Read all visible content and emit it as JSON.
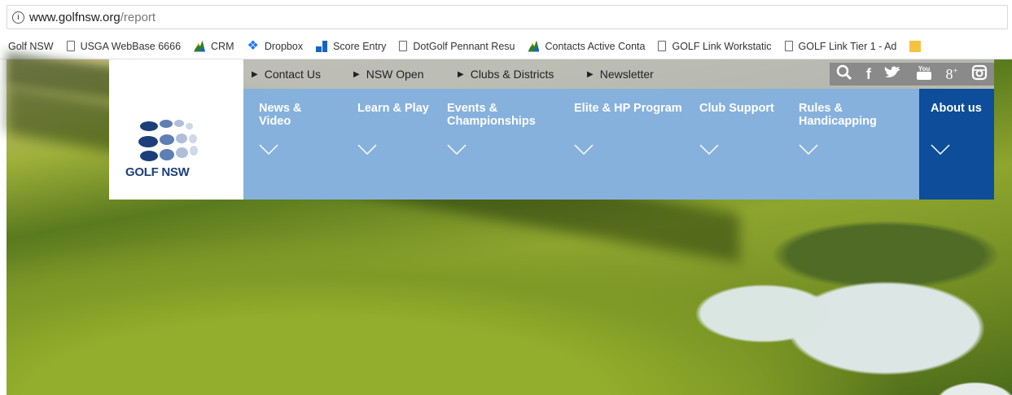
{
  "browser": {
    "url_host": "www.golfnsw.org",
    "url_path": "/report",
    "bookmarks": [
      {
        "label": "Golf NSW",
        "icon": "none"
      },
      {
        "label": "USGA WebBase 6666",
        "icon": "page-icon"
      },
      {
        "label": "CRM",
        "icon": "crm-icon"
      },
      {
        "label": "Dropbox",
        "icon": "dropbox-icon"
      },
      {
        "label": "Score Entry",
        "icon": "score-entry-icon"
      },
      {
        "label": "DotGolf Pennant Resu",
        "icon": "page-icon"
      },
      {
        "label": "Contacts Active Conta",
        "icon": "crm-icon"
      },
      {
        "label": "GOLF Link Workstatic",
        "icon": "page-icon"
      },
      {
        "label": "GOLF Link Tier 1 - Ad",
        "icon": "page-icon"
      }
    ]
  },
  "site": {
    "logo_text": "GOLF NSW",
    "top_links": [
      "Contact Us",
      "NSW Open",
      "Clubs & Districts",
      "Newsletter"
    ],
    "social_icons": [
      "search-icon",
      "facebook-icon",
      "twitter-icon",
      "youtube-icon",
      "google-plus-icon",
      "instagram-icon"
    ],
    "nav": [
      {
        "line1": "News &",
        "line2": "Video"
      },
      {
        "line1": "Learn & Play",
        "line2": ""
      },
      {
        "line1": "Events &",
        "line2": "Championships"
      },
      {
        "line1": "Elite & HP Program",
        "line2": ""
      },
      {
        "line1": "Club Support",
        "line2": ""
      },
      {
        "line1": "Rules &",
        "line2": "Handicapping"
      },
      {
        "line1": "About us",
        "line2": ""
      }
    ],
    "colors": {
      "nav_bg": "#86b1dc",
      "about_bg": "#0d4d99",
      "topbar_bg": "#bebebe",
      "logo_blue": "#1c3f7a"
    }
  }
}
